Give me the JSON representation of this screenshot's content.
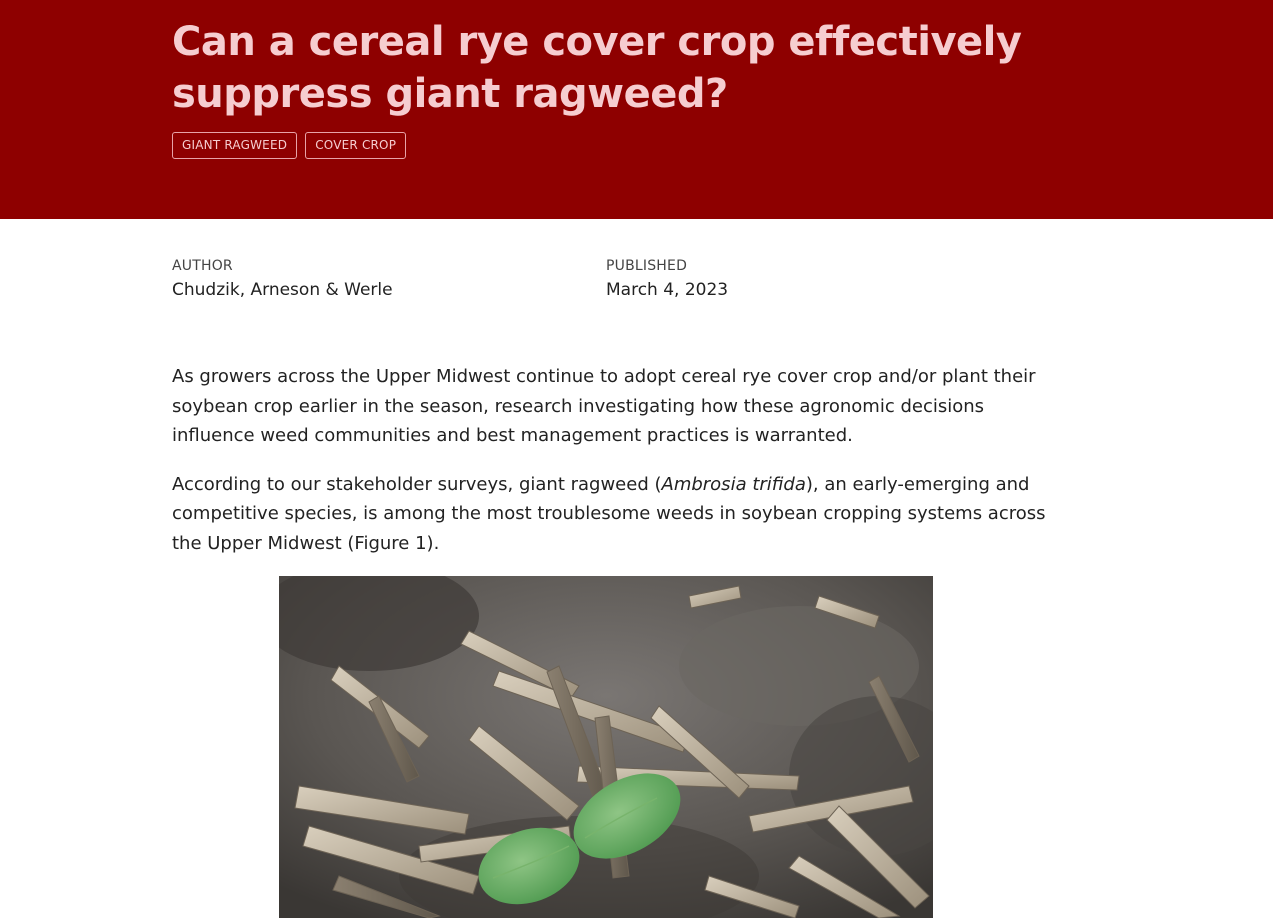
{
  "header": {
    "title": "Can a cereal rye cover crop effectively suppress giant ragweed?",
    "tags": [
      "GIANT RAGWEED",
      "COVER CROP"
    ],
    "background_color": "#8e0000",
    "title_color": "#f6cdd0"
  },
  "meta": {
    "author_label": "AUTHOR",
    "author_value": "Chudzik, Arneson & Werle",
    "published_label": "PUBLISHED",
    "published_value": "March 4, 2023"
  },
  "article": {
    "paragraph1": "As growers across the Upper Midwest continue to adopt cereal rye cover crop and/or plant their soybean crop earlier in the season, research investigating how these agronomic decisions influence weed communities and best management practices is warranted.",
    "paragraph2_before": "According to our stakeholder surveys, giant ragweed (",
    "paragraph2_italic": "Ambrosia trifida",
    "paragraph2_after": "), an early-emerging and competitive species, is among the most troublesome weeds in soybean cropping systems across the Upper Midwest (Figure 1)."
  },
  "figure": {
    "icon": "photo-giant-ragweed-seedling-in-residue"
  }
}
